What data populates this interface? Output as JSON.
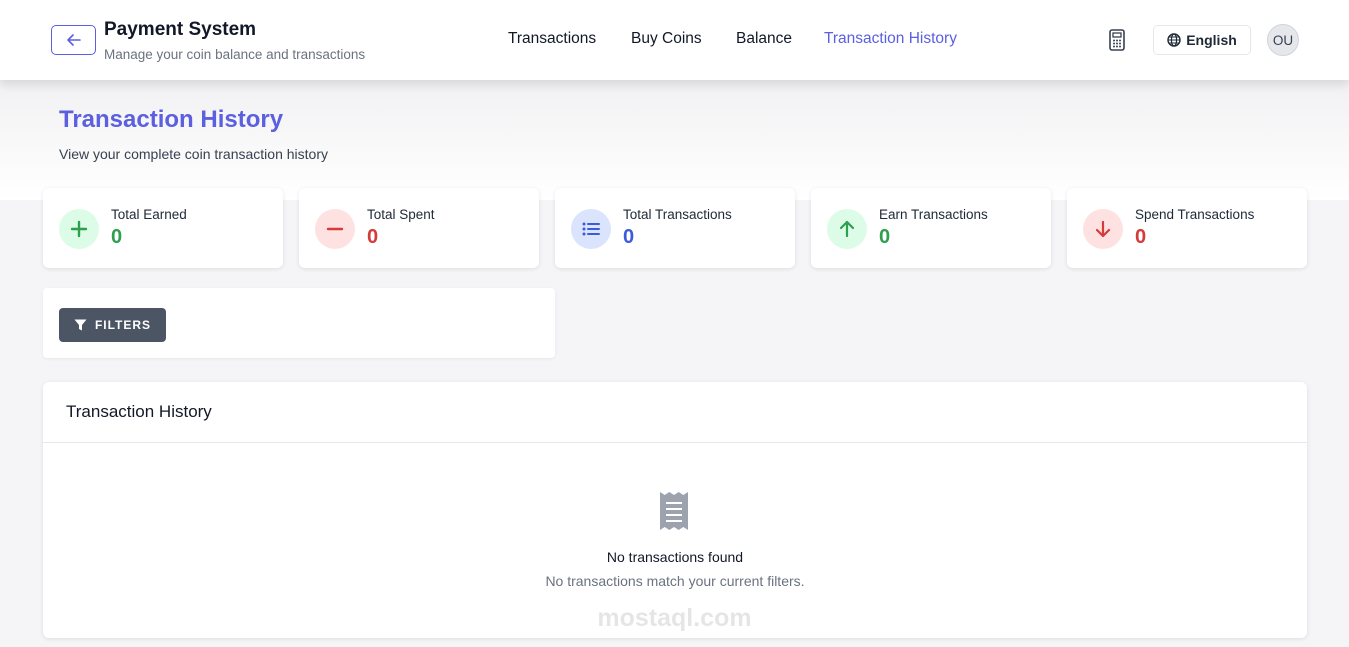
{
  "header": {
    "back_icon": "arrow-left-icon",
    "brand_title": "Payment System",
    "brand_subtitle": "Manage your coin balance and transactions",
    "nav": [
      {
        "label": "Transactions",
        "active": false
      },
      {
        "label": "Buy Coins",
        "active": false
      },
      {
        "label": "Balance",
        "active": false
      },
      {
        "label": "Transaction History",
        "active": true
      }
    ],
    "calculator_icon": "calculator-icon",
    "language": "English",
    "language_icon": "globe-icon",
    "avatar_initials": "OU"
  },
  "page": {
    "title": "Transaction History",
    "subtitle": "View your complete coin transaction history"
  },
  "stats": [
    {
      "label": "Total Earned",
      "value": "0",
      "icon": "plus-icon",
      "color": "#2e9e4f",
      "bg": "#dcfce7"
    },
    {
      "label": "Total Spent",
      "value": "0",
      "icon": "minus-icon",
      "color": "#d63a3a",
      "bg": "#fee2e2"
    },
    {
      "label": "Total Transactions",
      "value": "0",
      "icon": "list-icon",
      "color": "#3b5bdb",
      "bg": "#dbe4fd"
    },
    {
      "label": "Earn Transactions",
      "value": "0",
      "icon": "arrow-up-icon",
      "color": "#2e9e4f",
      "bg": "#dcfce7"
    },
    {
      "label": "Spend Transactions",
      "value": "0",
      "icon": "arrow-down-icon",
      "color": "#d63a3a",
      "bg": "#fee2e2"
    }
  ],
  "filters": {
    "label": "FILTERS",
    "icon": "filter-icon"
  },
  "history": {
    "title": "Transaction History",
    "empty_icon": "receipt-icon",
    "empty_title": "No transactions found",
    "empty_subtitle": "No transactions match your current filters."
  },
  "watermark": "mostaql.com",
  "colors": {
    "accent": "#5b5fe0",
    "filter_button": "#4b5563"
  }
}
